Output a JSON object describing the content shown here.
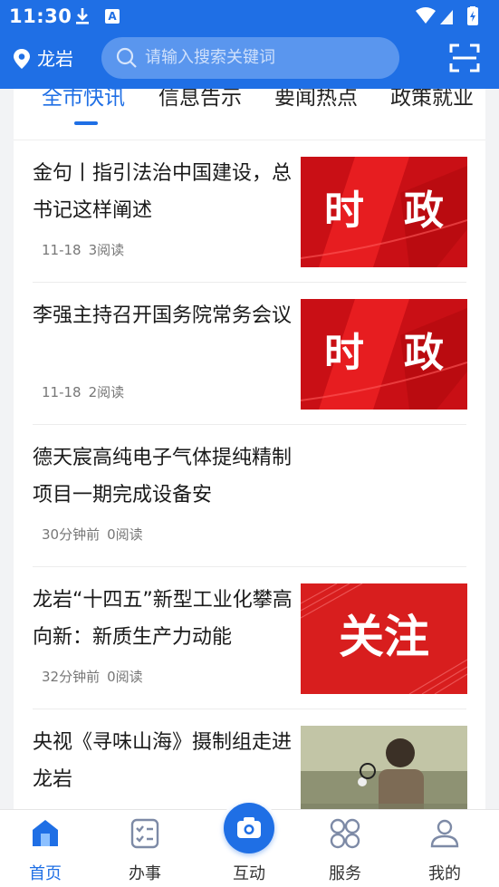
{
  "status_bar": {
    "time": "11:30"
  },
  "header": {
    "location": "龙岩",
    "search_placeholder": "请输入搜索关键词"
  },
  "tabs": [
    {
      "label": "全市快讯",
      "active": true
    },
    {
      "label": "信息告示",
      "active": false
    },
    {
      "label": "要闻热点",
      "active": false
    },
    {
      "label": "政策就业",
      "active": false
    }
  ],
  "news": [
    {
      "title": "金句丨指引法治中国建设，总书记这样阐述",
      "date": "11-18",
      "reads": "3阅读",
      "thumb": "时　政"
    },
    {
      "title": "李强主持召开国务院常务会议",
      "date": "11-18",
      "reads": "2阅读",
      "thumb": "时　政"
    },
    {
      "title": "德天宸高纯电子气体提纯精制项目一期完成设备安",
      "date": "30分钟前",
      "reads": "0阅读",
      "thumb": ""
    },
    {
      "title": "龙岩“十四五”新型工业化攀高向新：新质生产力动能",
      "date": "32分钟前",
      "reads": "0阅读",
      "thumb": "关注"
    },
    {
      "title": "央视《寻味山海》摄制组走进龙岩",
      "date": "",
      "reads": "",
      "thumb": ""
    }
  ],
  "bottom_nav": [
    {
      "label": "首页",
      "icon": "home-icon",
      "active": true
    },
    {
      "label": "办事",
      "icon": "checklist-icon",
      "active": false
    },
    {
      "label": "互动",
      "icon": "camera-icon",
      "active": false
    },
    {
      "label": "服务",
      "icon": "services-grid-icon",
      "active": false
    },
    {
      "label": "我的",
      "icon": "profile-icon",
      "active": false
    }
  ],
  "colors": {
    "brand_blue": "#1f6fe5",
    "politics_red": "#d7141a",
    "focus_red": "#d81e1e"
  }
}
